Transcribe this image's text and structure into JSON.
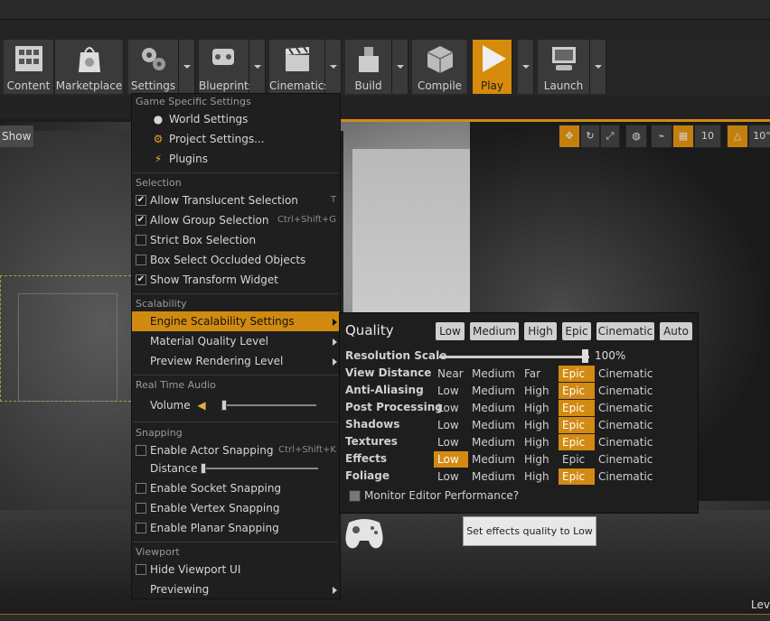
{
  "toolbar": {
    "buttons": [
      {
        "label": "Content"
      },
      {
        "label": "Marketplace"
      },
      {
        "label": "Settings"
      },
      {
        "label": "Blueprints"
      },
      {
        "label": "Cinematics"
      },
      {
        "label": "Build"
      },
      {
        "label": "Compile"
      },
      {
        "label": "Play"
      },
      {
        "label": "Launch"
      }
    ]
  },
  "viewport": {
    "show_label": "Show",
    "grid_snap_value": "10",
    "angle_snap_value": "10°",
    "corner_label": "Lev"
  },
  "menu": {
    "sections": {
      "game": "Game Specific Settings",
      "selection": "Selection",
      "scalability": "Scalability",
      "audio": "Real Time Audio",
      "snapping": "Snapping",
      "viewport": "Viewport"
    },
    "items": {
      "world_settings": "World Settings",
      "project_settings": "Project Settings...",
      "plugins": "Plugins",
      "allow_translucent": "Allow Translucent Selection",
      "allow_translucent_shortcut": "T",
      "allow_group": "Allow Group Selection",
      "allow_group_shortcut": "Ctrl+Shift+G",
      "strict_box": "Strict Box Selection",
      "box_occluded": "Box Select Occluded Objects",
      "show_transform": "Show Transform Widget",
      "engine_scalability": "Engine Scalability Settings",
      "material_quality": "Material Quality Level",
      "preview_rendering": "Preview Rendering Level",
      "volume": "Volume",
      "actor_snapping": "Enable Actor Snapping",
      "actor_snapping_shortcut": "Ctrl+Shift+K",
      "distance": "Distance",
      "socket_snapping": "Enable Socket Snapping",
      "vertex_snapping": "Enable Vertex Snapping",
      "planar_snapping": "Enable Planar Snapping",
      "hide_viewport_ui": "Hide Viewport UI",
      "previewing": "Previewing"
    },
    "checked": {
      "allow_translucent": true,
      "allow_group": true,
      "strict_box": false,
      "box_occluded": false,
      "show_transform": true,
      "actor_snapping": false,
      "socket_snapping": false,
      "vertex_snapping": false,
      "planar_snapping": false,
      "hide_viewport_ui": false
    }
  },
  "scalability": {
    "title": "Quality",
    "presets": [
      "Low",
      "Medium",
      "High",
      "Epic",
      "Cinematic",
      "Auto"
    ],
    "resolution_label": "Resolution Scale",
    "resolution_value": "100%",
    "resolution_fraction": 1.0,
    "rows": [
      {
        "label": "View Distance",
        "levels": [
          "Near",
          "Medium",
          "Far",
          "Epic",
          "Cinematic"
        ],
        "selected": 3
      },
      {
        "label": "Anti-Aliasing",
        "levels": [
          "Low",
          "Medium",
          "High",
          "Epic",
          "Cinematic"
        ],
        "selected": 3
      },
      {
        "label": "Post Processing",
        "levels": [
          "Low",
          "Medium",
          "High",
          "Epic",
          "Cinematic"
        ],
        "selected": 3
      },
      {
        "label": "Shadows",
        "levels": [
          "Low",
          "Medium",
          "High",
          "Epic",
          "Cinematic"
        ],
        "selected": 3
      },
      {
        "label": "Textures",
        "levels": [
          "Low",
          "Medium",
          "High",
          "Epic",
          "Cinematic"
        ],
        "selected": 3
      },
      {
        "label": "Effects",
        "levels": [
          "Low",
          "Medium",
          "High",
          "Epic",
          "Cinematic"
        ],
        "selected": 0
      },
      {
        "label": "Foliage",
        "levels": [
          "Low",
          "Medium",
          "High",
          "Epic",
          "Cinematic"
        ],
        "selected": 3
      }
    ],
    "monitor_label": "Monitor Editor Performance?"
  },
  "tooltip": "Set effects quality to Low",
  "colors": {
    "accent": "#d08a10",
    "menu_bg": "#1f1f1f"
  }
}
